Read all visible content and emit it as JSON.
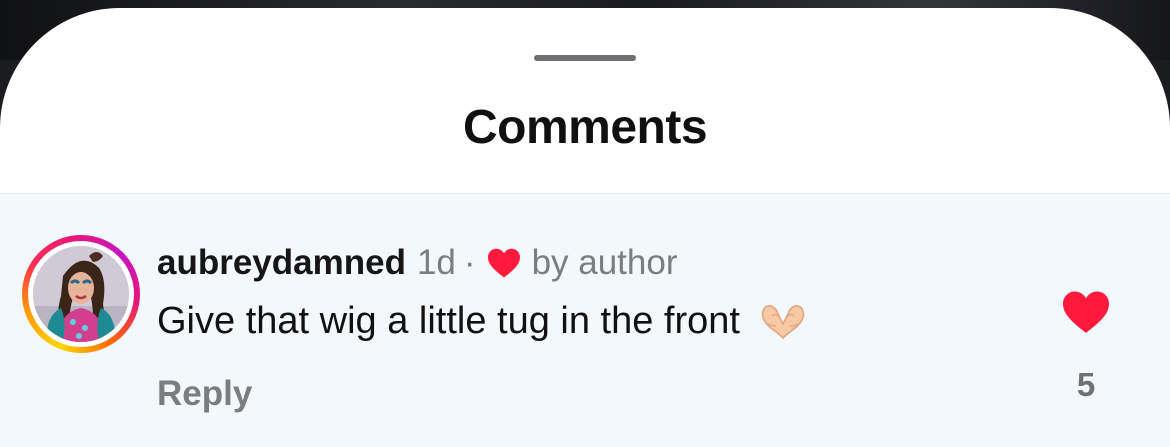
{
  "sheet": {
    "title": "Comments"
  },
  "comment": {
    "username": "aubreydamned",
    "time_ago": "1d",
    "separator": "·",
    "author_like_label": "by author",
    "text": "Give that wig a little tug in the front",
    "text_emoji": "heart-hands-emoji",
    "reply_label": "Reply",
    "like_count": "5",
    "liked": true
  },
  "icons": {
    "author_heart": "red-heart-icon",
    "like": "red-heart-icon",
    "emoji": "heart-hands-icon"
  },
  "colors": {
    "like_red": "#ff1a3d",
    "highlight_background": "#f2f8fb",
    "secondary_text": "#7a7d83"
  }
}
